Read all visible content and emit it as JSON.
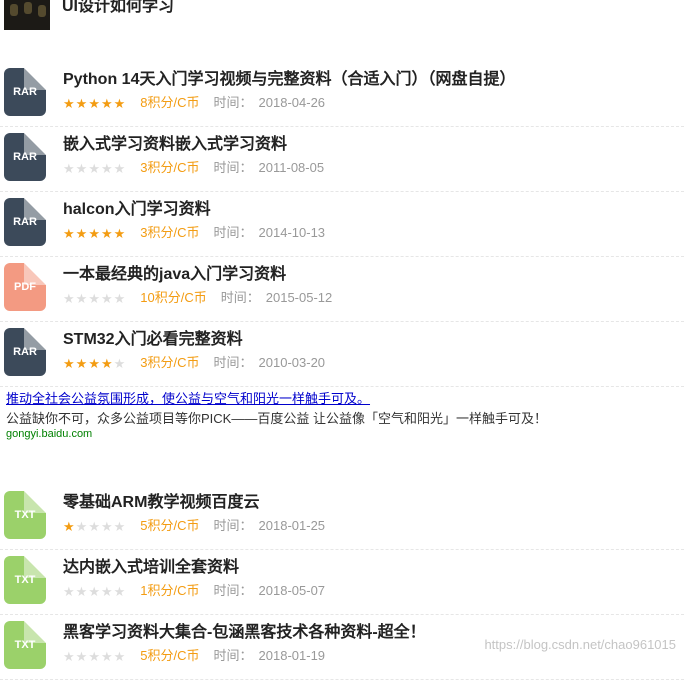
{
  "top_item": {
    "title": "UI设计如何学习"
  },
  "items": [
    {
      "type": "RAR",
      "title": "Python 14天入门学习视频与完整资料（合适入门）（网盘自提）",
      "stars": 5,
      "points": "8积分/C币",
      "time_label": "时间：",
      "time": "2018-04-26"
    },
    {
      "type": "RAR",
      "title": "嵌入式学习资料嵌入式学习资料",
      "stars": 0,
      "points": "3积分/C币",
      "time_label": "时间：",
      "time": "2011-08-05"
    },
    {
      "type": "RAR",
      "title": "halcon入门学习资料",
      "stars": 5,
      "points": "3积分/C币",
      "time_label": "时间：",
      "time": "2014-10-13"
    },
    {
      "type": "PDF",
      "title": "一本最经典的java入门学习资料",
      "stars": 0,
      "points": "10积分/C币",
      "time_label": "时间：",
      "time": "2015-05-12"
    },
    {
      "type": "RAR",
      "title": "STM32入门必看完整资料",
      "stars": 4,
      "points": "3积分/C币",
      "time_label": "时间：",
      "time": "2010-03-20"
    },
    {
      "type": "TXT",
      "title": "零基础ARM教学视频百度云",
      "stars": 1,
      "points": "5积分/C币",
      "time_label": "时间：",
      "time": "2018-01-25"
    },
    {
      "type": "TXT",
      "title": "达内嵌入式培训全套资料",
      "stars": 0,
      "points": "1积分/C币",
      "time_label": "时间：",
      "time": "2018-05-07"
    },
    {
      "type": "TXT",
      "title": "黑客学习资料大集合-包涵黑客技术各种资料-超全！",
      "stars": 0,
      "points": "5积分/C币",
      "time_label": "时间：",
      "time": "2018-01-19"
    }
  ],
  "ad": {
    "link": "推动全社会公益氛围形成，使公益与空气和阳光一样触手可及。",
    "desc": "公益缺你不可，众多公益项目等你PICK——百度公益 让公益像「空气和阳光」一样触手可及！",
    "url": "gongyi.baidu.com"
  },
  "watermark": "https://blog.csdn.net/chao961015",
  "colors": {
    "rar": "#3c4a5a",
    "pdf": "#f39a82",
    "txt": "#9bd16a",
    "star": "#f39c12",
    "points": "#f39c12"
  }
}
